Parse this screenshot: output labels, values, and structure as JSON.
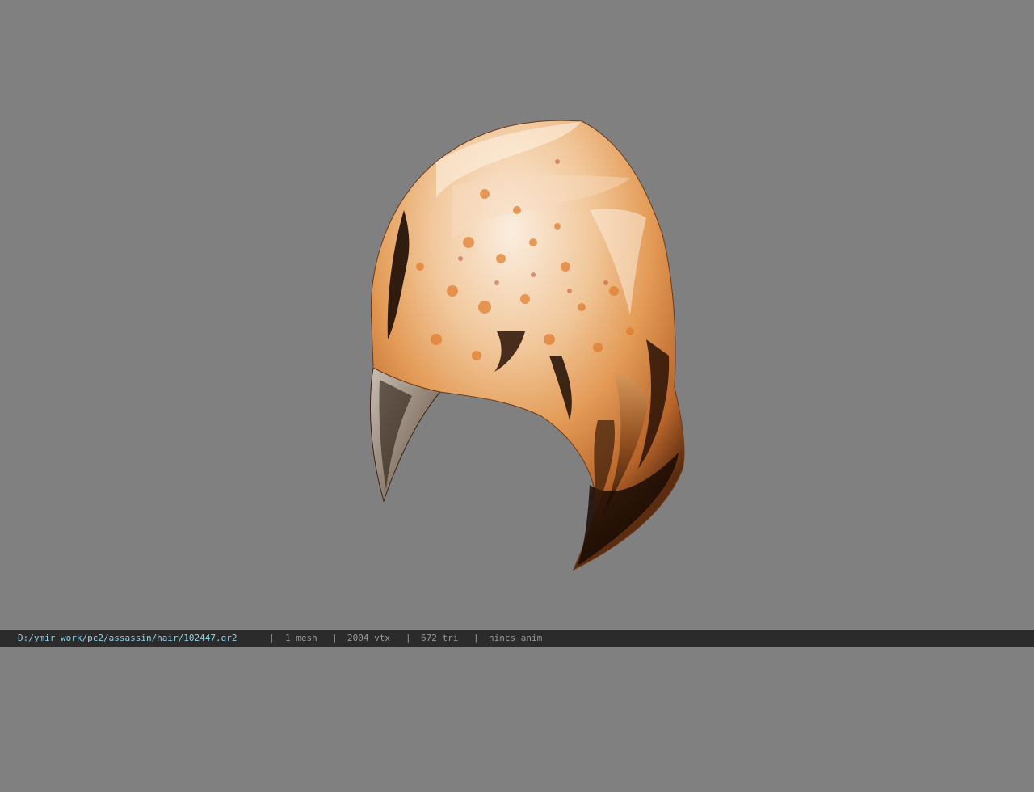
{
  "viewer": {
    "background_color": "#808080",
    "model_icon": "hair-mesh-model"
  },
  "status_bar": {
    "file_path": "D:/ymir work/pc2/assassin/hair/102447.gr2",
    "separator": "|",
    "mesh_count": "1 mesh",
    "vertex_count": "2004 vtx",
    "triangle_count": "672 tri",
    "anim_status": "nincs anim",
    "path_color": "#8fd3ea",
    "text_color": "#9a9a9a"
  }
}
